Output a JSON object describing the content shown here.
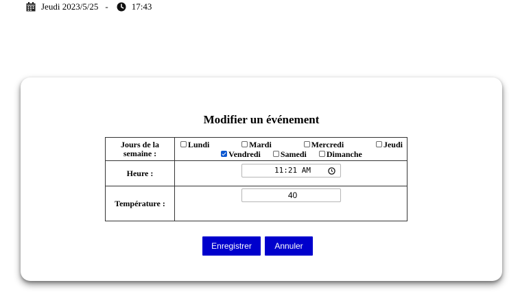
{
  "header": {
    "date_text": "Jeudi 2023/5/25",
    "separator": "-",
    "time_text": "17:43"
  },
  "dialog": {
    "title": "Modifier un événement",
    "days_label_line1": "Jours de la",
    "days_label_line2": "semaine :",
    "days": [
      {
        "label": "Lundi",
        "checked": false
      },
      {
        "label": "Mardi",
        "checked": false
      },
      {
        "label": "Mercredi",
        "checked": false
      },
      {
        "label": "Jeudi",
        "checked": false
      },
      {
        "label": "Vendredi",
        "checked": true
      },
      {
        "label": "Samedi",
        "checked": false
      },
      {
        "label": "Dimanche",
        "checked": false
      }
    ],
    "time_label": "Heure :",
    "time_value": "11:21 AM",
    "temperature_label": "Température :",
    "temperature_value": "40",
    "save_label": "Enregistrer",
    "cancel_label": "Annuler"
  },
  "colors": {
    "button_bg": "#0000cc",
    "checkbox_checked": "#0b57d0"
  }
}
